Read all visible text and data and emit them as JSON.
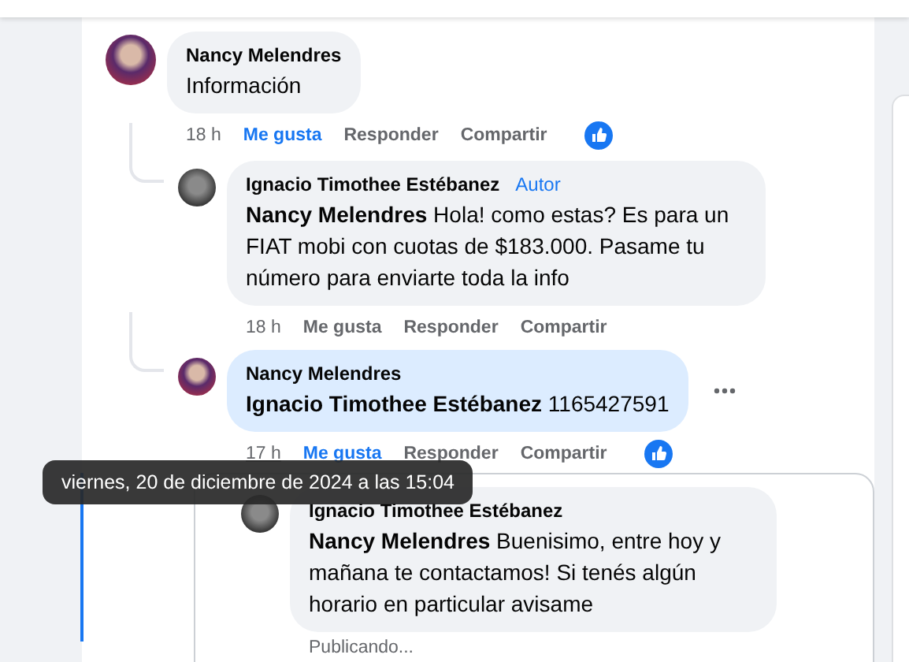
{
  "comments": [
    {
      "author": "Nancy Melendres",
      "body": "Información",
      "highlighted": false,
      "pending": false,
      "time": "18 h",
      "time_hovered": false,
      "like_label": "Me gusta",
      "liked": true,
      "reply_label": "Responder",
      "share_label": "Compartir",
      "reacted": true,
      "more_menu": false,
      "children": [
        {
          "author": "Ignacio Timothee Estébanez",
          "author_badge": "Autor",
          "body": "**Nancy Melendres** Hola! como estas? Es para un FIAT mobi con cuotas de $183.000. Pasame tu número para enviarte toda la info",
          "highlighted": false,
          "pending": false,
          "time": "18 h",
          "time_hovered": false,
          "like_label": "Me gusta",
          "liked": false,
          "reply_label": "Responder",
          "share_label": "Compartir",
          "reacted": false,
          "more_menu": false
        },
        {
          "author": "Nancy Melendres",
          "body": "**Ignacio Timothee Estébanez** 1165427591",
          "highlighted": true,
          "pending": false,
          "time": "17 h",
          "time_hovered": true,
          "like_label": "Me gusta",
          "liked": true,
          "reply_label": "Responder",
          "share_label": "Compartir",
          "reacted": true,
          "more_menu": true,
          "children": [
            {
              "author": "Ignacio Timothee Estébanez",
              "body": "**Nancy Melendres** Buenisimo, entre hoy y mañana te contactamos! Si tenés algún horario en particular avisame",
              "highlighted": false,
              "pending": true,
              "status": "Publicando..."
            }
          ]
        }
      ]
    }
  ],
  "tooltip": {
    "text": "viernes, 20 de diciembre de 2024 a las 15:04"
  }
}
